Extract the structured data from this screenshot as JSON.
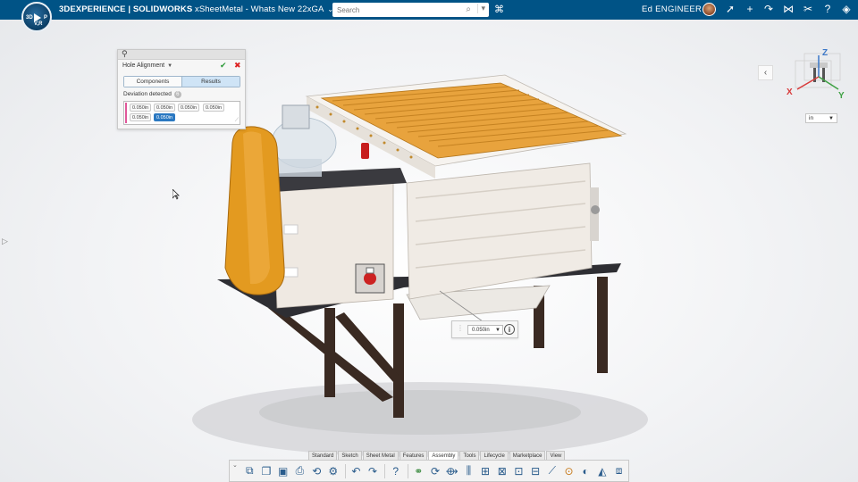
{
  "app": {
    "brand_prefix": "3DEXPERIENCE | SOLIDWORKS",
    "document_title": "xSheetMetal - Whats New 22xGA",
    "compass_top": "",
    "compass_left": "3D",
    "compass_right": "P",
    "compass_bottom": "V,R"
  },
  "search": {
    "placeholder": "Search"
  },
  "user": {
    "name": "Ed ENGINEER"
  },
  "top_icons": [
    "share-icon",
    "plus-icon",
    "collaborate-icon",
    "network-icon",
    "tools-icon",
    "help-icon",
    "compass-apps-icon"
  ],
  "panel": {
    "title": "Hole Alignment",
    "tabs": [
      "Components",
      "Results"
    ],
    "active_tab": "Results",
    "deviation_label": "Deviation detected",
    "deviation_count": "6",
    "values": [
      "0.050in",
      "0.050in",
      "0.050in",
      "0.050in",
      "0.050in",
      "0.050in"
    ],
    "selected_index": 5
  },
  "units": {
    "selected": "in"
  },
  "triad": {
    "x": "X",
    "y": "Y",
    "z": "Z"
  },
  "callout": {
    "value": "0.050in"
  },
  "bottom_tabs": [
    "Standard",
    "Sketch",
    "Sheet Metal",
    "Features",
    "Assembly",
    "Tools",
    "Lifecycle",
    "Marketplace",
    "View"
  ],
  "active_bottom_tab": "Assembly",
  "colors": {
    "header": "#005386",
    "accent": "#2a78c1",
    "conveyor": "#e8a33d",
    "guard": "#e39a20"
  }
}
